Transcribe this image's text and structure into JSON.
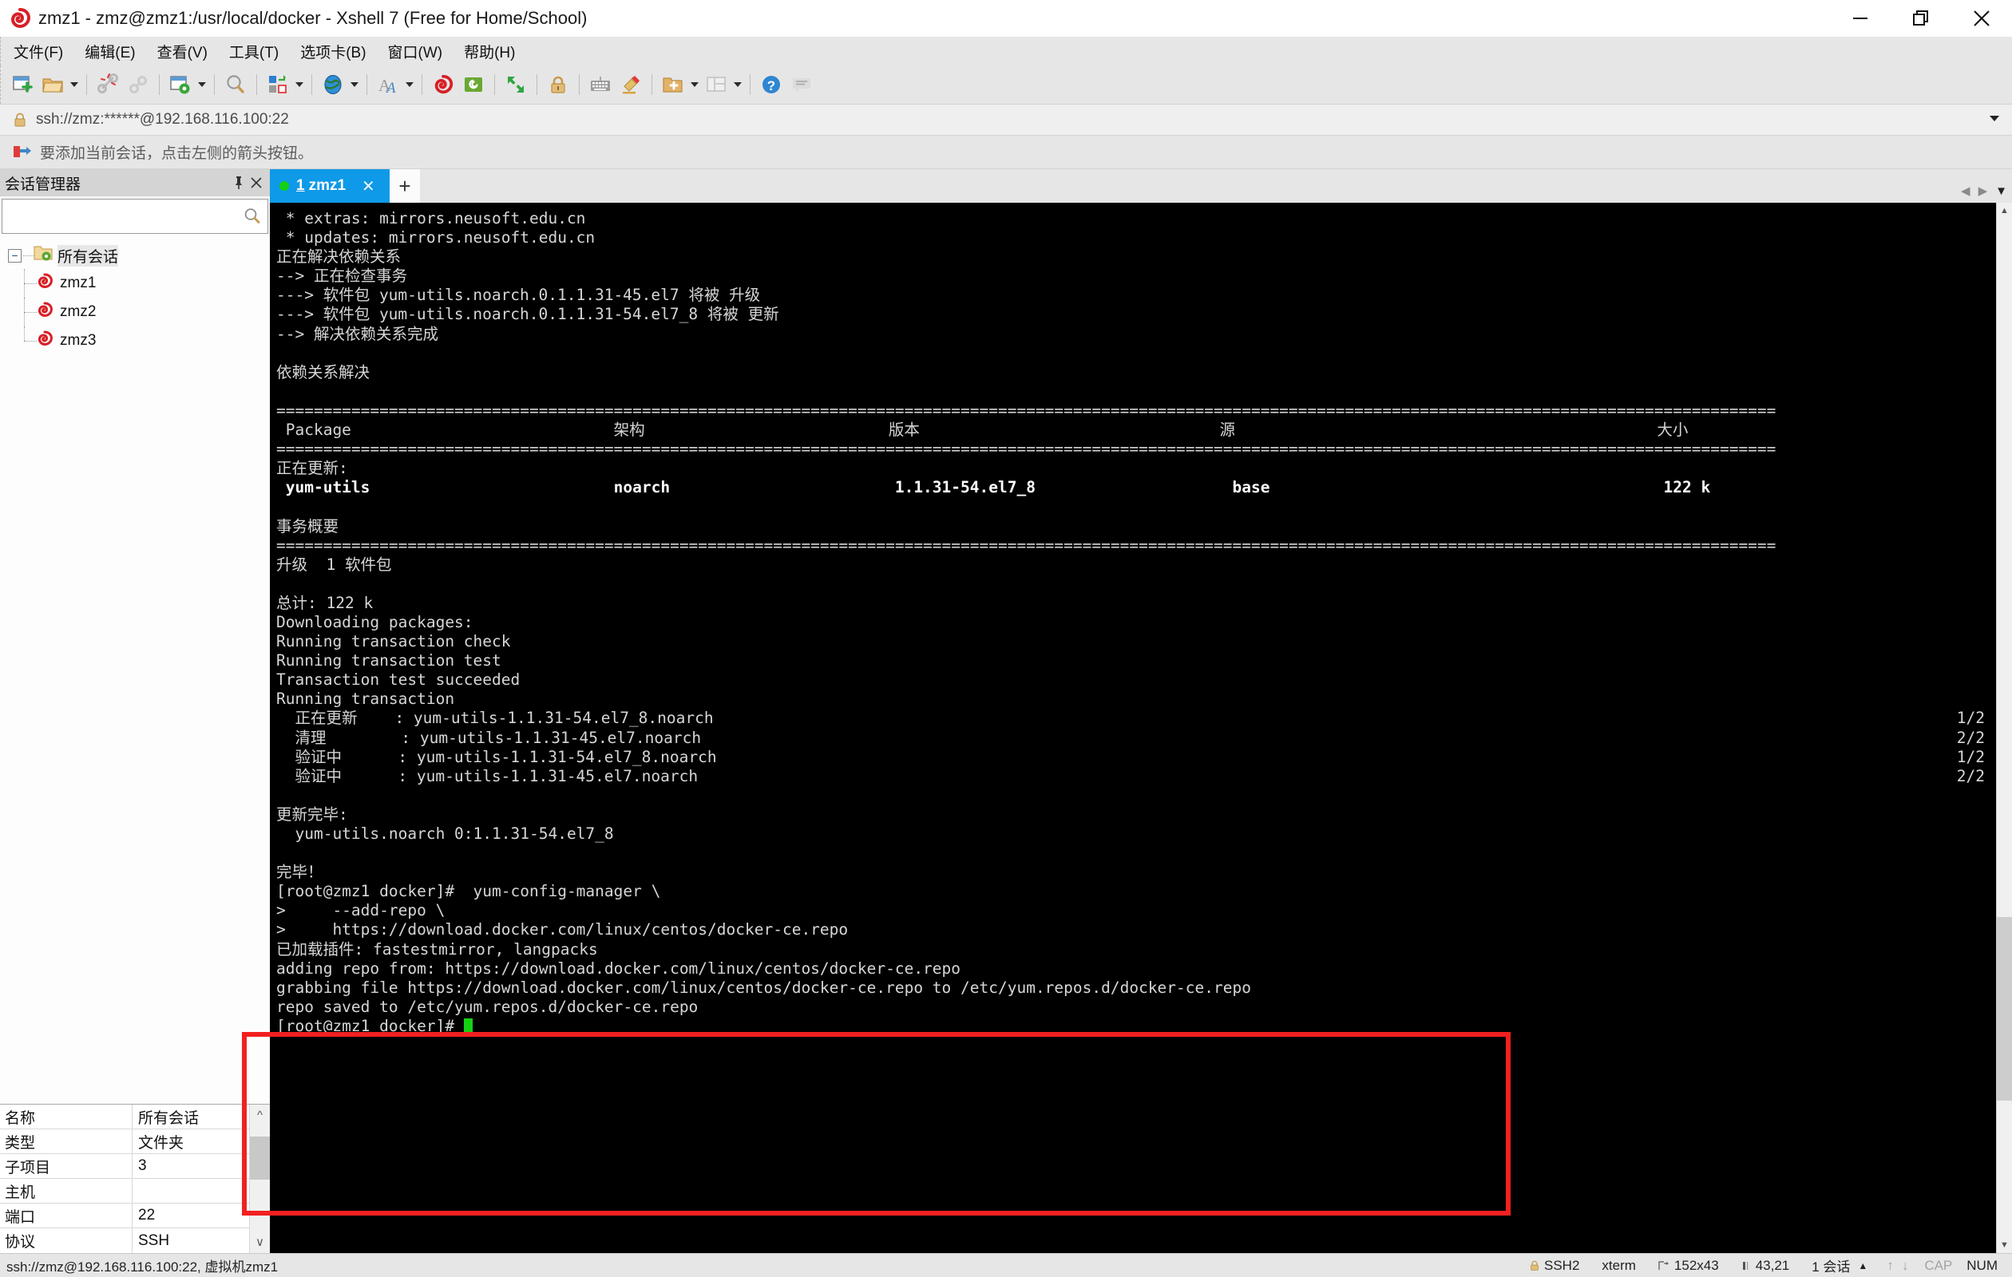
{
  "window": {
    "title": "zmz1 - zmz@zmz1:/usr/local/docker - Xshell 7 (Free for Home/School)",
    "minimize_label": "minimize-icon",
    "restore_label": "restore-icon",
    "close_label": "close-icon"
  },
  "menu": [
    {
      "label": "文件(F)",
      "name": "menu-file"
    },
    {
      "label": "编辑(E)",
      "name": "menu-edit"
    },
    {
      "label": "查看(V)",
      "name": "menu-view"
    },
    {
      "label": "工具(T)",
      "name": "menu-tools"
    },
    {
      "label": "选项卡(B)",
      "name": "menu-tabs"
    },
    {
      "label": "窗口(W)",
      "name": "menu-window"
    },
    {
      "label": "帮助(H)",
      "name": "menu-help"
    }
  ],
  "toolbar": {
    "icons": [
      "new-session-icon",
      "open-folder-icon",
      "disconnect-icon",
      "reconnect-icon",
      "session-properties-icon",
      "find-icon",
      "transfer-icon",
      "globe-icon",
      "font-icon",
      "xshell-icon",
      "xftp-icon",
      "fullscreen-icon",
      "lock-icon",
      "keyboard-icon",
      "highlight-icon",
      "add-folder-icon",
      "layout-icon",
      "help-icon",
      "comment-icon"
    ]
  },
  "address": {
    "lock_icon": "lock-icon",
    "value": "ssh://zmz:******@192.168.116.100:22",
    "dropdown_icon": "chevron-down-icon"
  },
  "notice": {
    "icon": "arrow-flag-icon",
    "text": "要添加当前会话，点击左侧的箭头按钮。"
  },
  "session_manager": {
    "title": "会话管理器",
    "pin_icon": "pin-icon",
    "close_icon": "close-icon",
    "search_placeholder": "",
    "search_value": "",
    "search_icon": "search-icon",
    "tree": {
      "root": {
        "label": "所有会话",
        "icon": "folder-gear-icon",
        "expander": "−"
      },
      "children": [
        {
          "label": "zmz1",
          "icon": "xshell-session-icon"
        },
        {
          "label": "zmz2",
          "icon": "xshell-session-icon"
        },
        {
          "label": "zmz3",
          "icon": "xshell-session-icon"
        }
      ]
    },
    "properties": [
      {
        "key": "名称",
        "value": "所有会话"
      },
      {
        "key": "类型",
        "value": "文件夹"
      },
      {
        "key": "子项目",
        "value": "3"
      },
      {
        "key": "主机",
        "value": ""
      },
      {
        "key": "端口",
        "value": "22"
      },
      {
        "key": "协议",
        "value": "SSH"
      }
    ],
    "scroll_up_icon": "chevron-up-icon",
    "scroll_down_icon": "chevron-down-icon"
  },
  "tabs": {
    "items": [
      {
        "number": "1",
        "label": "zmz1",
        "status_dot": "connected",
        "close_icon": "close-icon"
      }
    ],
    "new_tab_icon": "plus-icon",
    "scroll_left_icon": "chevron-left-icon",
    "scroll_right_icon": "chevron-right-icon",
    "menu_icon": "chevron-down-icon"
  },
  "terminal": {
    "lines": [
      {
        "text": " * extras: mirrors.neusoft.edu.cn"
      },
      {
        "text": " * updates: mirrors.neusoft.edu.cn"
      },
      {
        "text": "正在解决依赖关系"
      },
      {
        "text": "--> 正在检查事务"
      },
      {
        "text": "---> 软件包 yum-utils.noarch.0.1.1.31-45.el7 将被 升级"
      },
      {
        "text": "---> 软件包 yum-utils.noarch.0.1.1.31-54.el7_8 将被 更新"
      },
      {
        "text": "--> 解决依赖关系完成"
      },
      {
        "text": ""
      },
      {
        "text": "依赖关系解决"
      },
      {
        "text": ""
      },
      {
        "text": "================================================================================================================================================================"
      },
      {
        "text": " Package                            架构                          版本                                源                                             大小"
      },
      {
        "text": "================================================================================================================================================================"
      },
      {
        "text": "正在更新:"
      },
      {
        "text": " yum-utils                          noarch                        1.1.31-54.el7_8                     base                                          122 k",
        "bold": true
      },
      {
        "text": ""
      },
      {
        "text": "事务概要"
      },
      {
        "text": "================================================================================================================================================================"
      },
      {
        "text": "升级  1 软件包"
      },
      {
        "text": ""
      },
      {
        "text": "总计: 122 k"
      },
      {
        "text": "Downloading packages:"
      },
      {
        "text": "Running transaction check"
      },
      {
        "text": "Running transaction test"
      },
      {
        "text": "Transaction test succeeded"
      },
      {
        "text": "Running transaction"
      },
      {
        "text": "  正在更新    : yum-utils-1.1.31-54.el7_8.noarch",
        "right": "1/2"
      },
      {
        "text": "  清理        : yum-utils-1.1.31-45.el7.noarch",
        "right": "2/2"
      },
      {
        "text": "  验证中      : yum-utils-1.1.31-54.el7_8.noarch",
        "right": "1/2"
      },
      {
        "text": "  验证中      : yum-utils-1.1.31-45.el7.noarch",
        "right": "2/2"
      },
      {
        "text": ""
      },
      {
        "text": "更新完毕:"
      },
      {
        "text": "  yum-utils.noarch 0:1.1.31-54.el7_8"
      },
      {
        "text": ""
      },
      {
        "text": "完毕！"
      },
      {
        "text": "[root@zmz1 docker]#  yum-config-manager \\"
      },
      {
        "text": ">     --add-repo \\"
      },
      {
        "text": ">     https://download.docker.com/linux/centos/docker-ce.repo"
      },
      {
        "text": "已加载插件: fastestmirror, langpacks"
      },
      {
        "text": "adding repo from: https://download.docker.com/linux/centos/docker-ce.repo"
      },
      {
        "text": "grabbing file https://download.docker.com/linux/centos/docker-ce.repo to /etc/yum.repos.d/docker-ce.repo"
      },
      {
        "text": "repo saved to /etc/yum.repos.d/docker-ce.repo"
      },
      {
        "text": "[root@zmz1 docker]# ",
        "cursor": true
      }
    ],
    "package_table": {
      "headers": [
        "Package",
        "架构",
        "版本",
        "源",
        "大小"
      ],
      "rows": [
        [
          "yum-utils",
          "noarch",
          "1.1.31-54.el7_8",
          "base",
          "122 k"
        ]
      ]
    },
    "annotation": {
      "shape": "rectangle",
      "color": "#f22020"
    }
  },
  "statusbar": {
    "left": "ssh://zmz@192.168.116.100:22, 虚拟机zmz1",
    "right": [
      {
        "icon": "lock-icon",
        "label": "SSH2",
        "name": "status-protocol"
      },
      {
        "icon": "",
        "label": "xterm",
        "name": "status-terminal-type"
      },
      {
        "icon": "size-icon",
        "label": "152x43",
        "name": "status-size"
      },
      {
        "icon": "cursor-icon",
        "label": "43,21",
        "name": "status-cursor"
      },
      {
        "icon": "",
        "label": "1 会话",
        "name": "status-sessions"
      },
      {
        "icon": "caret-up-icon",
        "label": "",
        "name": "status-sessions-expand"
      },
      {
        "icon": "arrow-up-icon",
        "label": "",
        "name": "status-upload"
      },
      {
        "icon": "arrow-down-icon",
        "label": "",
        "name": "status-download"
      },
      {
        "icon": "",
        "label": "CAP",
        "name": "status-caps",
        "dim": true
      },
      {
        "icon": "",
        "label": "NUM",
        "name": "status-num"
      }
    ]
  }
}
